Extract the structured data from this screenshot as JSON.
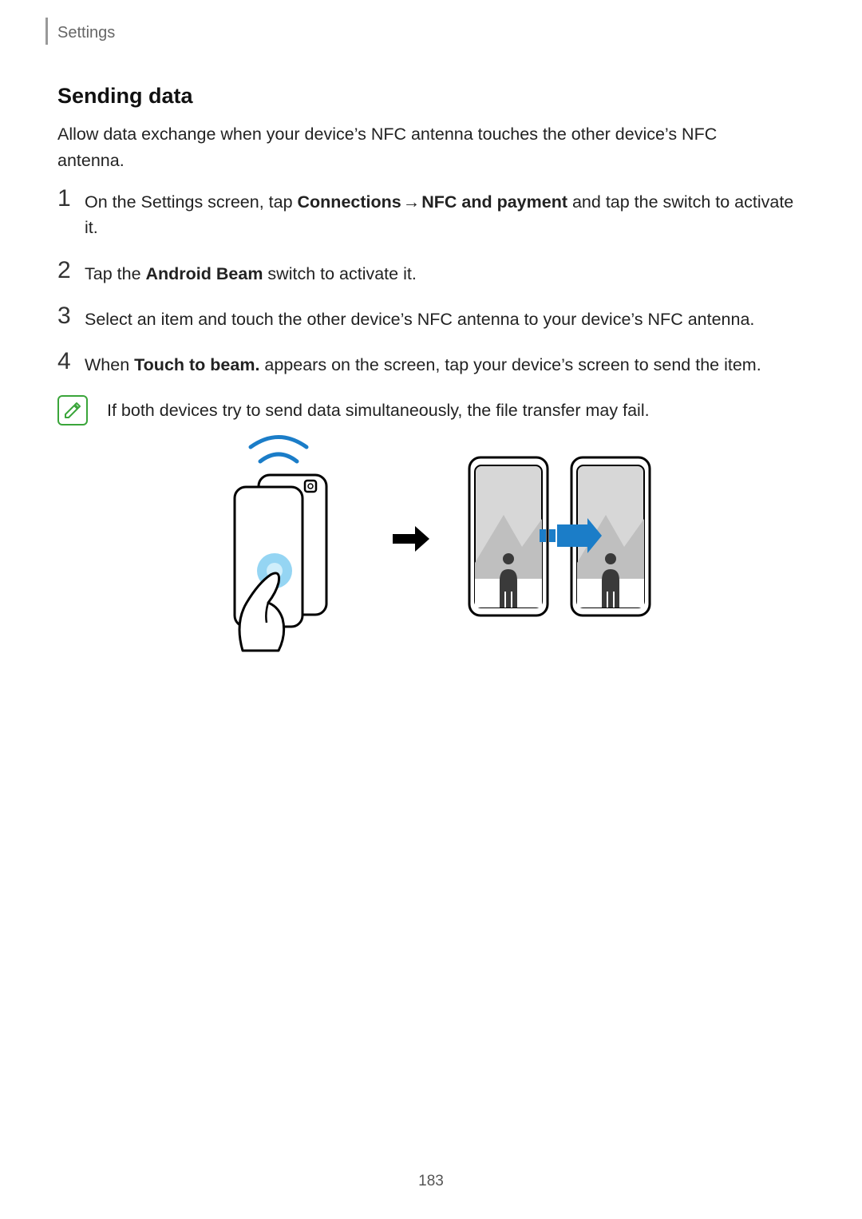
{
  "header": {
    "breadcrumb": "Settings"
  },
  "section": {
    "title": "Sending data",
    "intro": "Allow data exchange when your device’s NFC antenna touches the other device’s NFC antenna."
  },
  "steps": [
    {
      "num": "1",
      "prefix": "On the Settings screen, tap ",
      "bold1": "Connections",
      "mid": " → ",
      "bold2": "NFC and payment",
      "suffix": " and tap the switch to activate it."
    },
    {
      "num": "2",
      "prefix": "Tap the ",
      "bold1": "Android Beam",
      "mid": "",
      "bold2": "",
      "suffix": " switch to activate it."
    },
    {
      "num": "3",
      "prefix": "Select an item and touch the other device’s NFC antenna to your device’s NFC antenna.",
      "bold1": "",
      "mid": "",
      "bold2": "",
      "suffix": ""
    },
    {
      "num": "4",
      "prefix": "When ",
      "bold1": "Touch to beam.",
      "mid": "",
      "bold2": "",
      "suffix": " appears on the screen, tap your device’s screen to send the item."
    }
  ],
  "note": {
    "text": "If both devices try to send data simultaneously, the file transfer may fail."
  },
  "footer": {
    "page": "183"
  }
}
